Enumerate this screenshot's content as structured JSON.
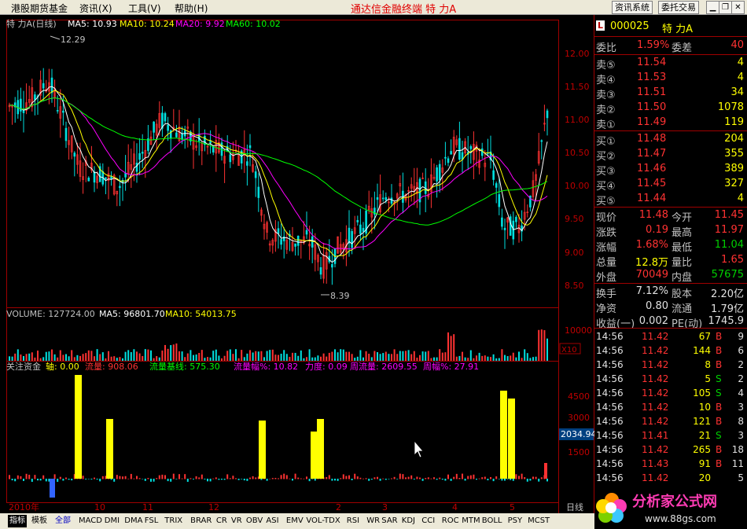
{
  "menubar": {
    "items": [
      "港股期货基金",
      "资讯(X)",
      "工具(V)",
      "帮助(H)"
    ],
    "title": "通达信金融终端  特  力A",
    "btn_info": "资讯系统",
    "btn_trade": "委托交易"
  },
  "chart_header": {
    "name": "特  力A(日线)",
    "ma5": "MA5: 10.93",
    "ma10": "MA10: 10.24",
    "ma20": "MA20: 9.92",
    "ma60": "MA60: 10.02",
    "high_mark": "12.29",
    "low_mark": "8.39"
  },
  "volume_header": {
    "volume": "VOLUME: 127724.00",
    "ma5": "MA5: 96801.70",
    "ma10": "MA10: 54013.75",
    "scale": "10000",
    "unit": "X10"
  },
  "flow_header": {
    "name": "关注资金",
    "axis": "轴: 0.00",
    "flow": "流量: 908.06",
    "base": "流量基线: 575.30",
    "pct": "流量幅%: 10.82",
    "force": "力度: 0.09",
    "week": "周流量: 2609.55",
    "week_pct": "周幅%: 27.91"
  },
  "price_axis": [
    "12.00",
    "11.50",
    "11.00",
    "10.50",
    "10.00",
    "9.50",
    "9.00",
    "8.50"
  ],
  "flow_axis": [
    "4500",
    "3000",
    "2034.94",
    "1500"
  ],
  "date_axis": [
    "2010年",
    "10",
    "11",
    "12",
    "2",
    "3",
    "4",
    "5"
  ],
  "period_label": "日线",
  "quote": {
    "code": "000025",
    "name": "特  力A",
    "weibi_label": "委比",
    "weibi": "1.59%",
    "weicha_label": "委差",
    "weicha": "40",
    "asks": [
      {
        "label": "卖⑤",
        "price": "11.54",
        "vol": "4"
      },
      {
        "label": "卖④",
        "price": "11.53",
        "vol": "4"
      },
      {
        "label": "卖③",
        "price": "11.51",
        "vol": "34"
      },
      {
        "label": "卖②",
        "price": "11.50",
        "vol": "1078"
      },
      {
        "label": "卖①",
        "price": "11.49",
        "vol": "119"
      }
    ],
    "bids": [
      {
        "label": "买①",
        "price": "11.48",
        "vol": "204"
      },
      {
        "label": "买②",
        "price": "11.47",
        "vol": "355"
      },
      {
        "label": "买③",
        "price": "11.46",
        "vol": "389"
      },
      {
        "label": "买④",
        "price": "11.45",
        "vol": "327"
      },
      {
        "label": "买⑤",
        "price": "11.44",
        "vol": "4"
      }
    ],
    "stats": [
      {
        "l1": "现价",
        "v1": "11.48",
        "l2": "今开",
        "v2": "11.45"
      },
      {
        "l1": "涨跌",
        "v1": "0.19",
        "l2": "最高",
        "v2": "11.97"
      },
      {
        "l1": "涨幅",
        "v1": "1.68%",
        "l2": "最低",
        "v2": "11.04"
      },
      {
        "l1": "总量",
        "v1": "12.8万",
        "l2": "量比",
        "v2": "1.65"
      },
      {
        "l1": "外盘",
        "v1": "70049",
        "l2": "内盘",
        "v2": "57675"
      }
    ],
    "stats2": [
      {
        "l1": "换手",
        "v1": "7.12%",
        "l2": "股本",
        "v2": "2.20亿"
      },
      {
        "l1": "净资",
        "v1": "0.80",
        "l2": "流通",
        "v2": "1.79亿"
      },
      {
        "l1": "收益(一)",
        "v1": "0.002",
        "l2": "PE(动)",
        "v2": "1745.9"
      }
    ],
    "ticks": [
      {
        "time": "14:56",
        "price": "11.42",
        "vol": "67",
        "side": "B",
        "n": "9"
      },
      {
        "time": "14:56",
        "price": "11.42",
        "vol": "144",
        "side": "B",
        "n": "6"
      },
      {
        "time": "14:56",
        "price": "11.42",
        "vol": "8",
        "side": "B",
        "n": "2"
      },
      {
        "time": "14:56",
        "price": "11.42",
        "vol": "5",
        "side": "S",
        "n": "2"
      },
      {
        "time": "14:56",
        "price": "11.42",
        "vol": "105",
        "side": "S",
        "n": "4"
      },
      {
        "time": "14:56",
        "price": "11.42",
        "vol": "10",
        "side": "B",
        "n": "3"
      },
      {
        "time": "14:56",
        "price": "11.42",
        "vol": "121",
        "side": "B",
        "n": "8"
      },
      {
        "time": "14:56",
        "price": "11.41",
        "vol": "21",
        "side": "S",
        "n": "3"
      },
      {
        "time": "14:56",
        "price": "11.42",
        "vol": "265",
        "side": "B",
        "n": "18"
      },
      {
        "time": "14:56",
        "price": "11.43",
        "vol": "91",
        "side": "B",
        "n": "11"
      },
      {
        "time": "14:56",
        "price": "11.42",
        "vol": "20",
        "side": "",
        "n": "5"
      }
    ]
  },
  "tabs": [
    "指标",
    "模板",
    "全部",
    "MACD",
    "DMI",
    "DMA",
    "FSL",
    "TRIX",
    "BRAR",
    "CR",
    "VR",
    "OBV",
    "ASI",
    "EMV",
    "VOL-TDX",
    "RSI",
    "WR",
    "SAR",
    "KDJ",
    "CCI",
    "ROC",
    "MTM",
    "BOLL",
    "PSY",
    "MCST"
  ],
  "logo": {
    "text": "分析家公式网",
    "url": "www.88gs.com"
  },
  "colors": {
    "up": "#ff3232",
    "down": "#00e0e0",
    "ma5": "#ffffff",
    "ma10": "#ffff00",
    "ma20": "#ff00ff",
    "ma60": "#00ff00",
    "flow": "#ffff00"
  }
}
